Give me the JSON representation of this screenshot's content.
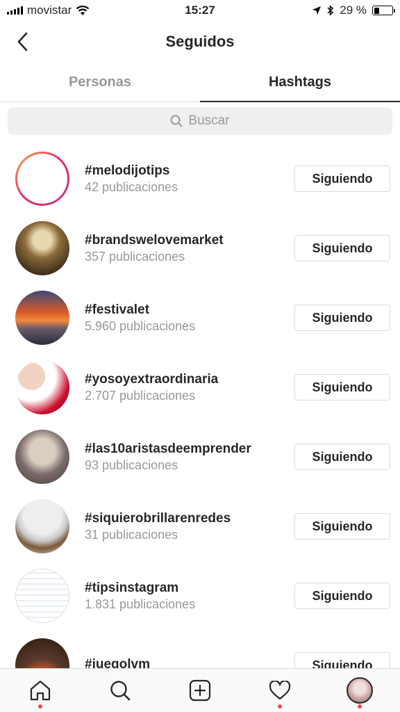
{
  "status_bar": {
    "carrier": "movistar",
    "time": "15:27",
    "battery_text": "29 %",
    "battery_level": 0.29
  },
  "header": {
    "title": "Seguidos"
  },
  "tabs": [
    {
      "label": "Personas",
      "active": false
    },
    {
      "label": "Hashtags",
      "active": true
    }
  ],
  "search": {
    "placeholder": "Buscar"
  },
  "hashtags": [
    {
      "tag": "#melodijotips",
      "count": "42 publicaciones",
      "button": "Siguiendo"
    },
    {
      "tag": "#brandswelovemarket",
      "count": "357 publicaciones",
      "button": "Siguiendo"
    },
    {
      "tag": "#festivalet",
      "count": "5.960 publicaciones",
      "button": "Siguiendo"
    },
    {
      "tag": "#yosoyextraordinaria",
      "count": "2.707 publicaciones",
      "button": "Siguiendo"
    },
    {
      "tag": "#las10aristasdeemprender",
      "count": "93 publicaciones",
      "button": "Siguiendo"
    },
    {
      "tag": "#siquierobrillarenredes",
      "count": "31 publicaciones",
      "button": "Siguiendo"
    },
    {
      "tag": "#tipsinstagram",
      "count": "1.831 publicaciones",
      "button": "Siguiendo"
    },
    {
      "tag": "#juegolvm",
      "count": "",
      "button": "Siguiendo"
    }
  ],
  "bottom_nav": {
    "items": [
      "home-icon",
      "search-icon",
      "add-post-icon",
      "heart-icon",
      "profile-avatar"
    ],
    "notification_color": "#ed4956"
  }
}
